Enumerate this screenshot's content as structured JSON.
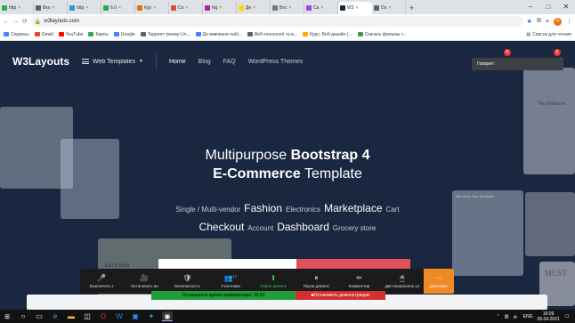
{
  "browser": {
    "tabs": [
      {
        "label": "http",
        "color": "#34a853"
      },
      {
        "label": "Вхо",
        "color": "#5f6368"
      },
      {
        "label": "http",
        "color": "#1fa2c7"
      },
      {
        "label": "6.0",
        "color": "#34a853"
      },
      {
        "label": "Кур",
        "color": "#e8710a"
      },
      {
        "label": "Co",
        "color": "#dd4b39"
      },
      {
        "label": "Ng",
        "color": "#b0249b"
      },
      {
        "label": "Де",
        "color": "#ffd500"
      },
      {
        "label": "Boc",
        "color": "#777777"
      },
      {
        "label": "Ca",
        "color": "#a142f4"
      },
      {
        "label": "W3",
        "color": "#1a2740",
        "active": true
      },
      {
        "label": "Do",
        "color": "#5f6368"
      }
    ],
    "url": "w3layouts.com",
    "profile_letter": "A",
    "bookmarks": [
      {
        "label": "Сервисы",
        "color": "#4285f4"
      },
      {
        "label": "Gmail",
        "color": "#ea4335"
      },
      {
        "label": "YouTube",
        "color": "#ff0000"
      },
      {
        "label": "Карты",
        "color": "#34a853"
      },
      {
        "label": "Google",
        "color": "#4285f4"
      },
      {
        "label": "Торрент трекер Un...",
        "color": "#5f6368"
      },
      {
        "label": "До вивчення лабі...",
        "color": "#4285f4"
      },
      {
        "label": "Веб-технології та в...",
        "color": "#5f6368"
      },
      {
        "label": "Курс: Веб-дизайн (...",
        "color": "#f9ab00"
      },
      {
        "label": "Скачать фильмы т...",
        "color": "#3c9b41"
      }
    ],
    "reading_list": "Список для чтения"
  },
  "site": {
    "logo": "W3Layouts",
    "menu_label": "Web Templates",
    "nav": [
      "Home",
      "Blog",
      "FAQ",
      "WordPress Themes"
    ],
    "badges": [
      "0",
      "0"
    ],
    "tooltip": "Говорит:"
  },
  "hero": {
    "line1_light": "Multipurpose ",
    "line1_bold": "Bootstrap 4",
    "line2_bold": "E-Commerce",
    "line2_light": " Template",
    "tags_row1": [
      {
        "text": "Single / Multi-vendor",
        "size": "sm"
      },
      {
        "text": "Fashion",
        "size": "lg"
      },
      {
        "text": "Electronics",
        "size": "sm"
      },
      {
        "text": "Marketplace",
        "size": "lg"
      },
      {
        "text": "Cart",
        "size": "sm"
      }
    ],
    "tags_row2": [
      {
        "text": "Checkout",
        "size": "lg"
      },
      {
        "text": "Account",
        "size": "sm"
      },
      {
        "text": "Dashboard",
        "size": "lg"
      },
      {
        "text": "Grocery store",
        "size": "sm"
      }
    ],
    "card_fragments": {
      "we_grow": "We Grow Your Business",
      "brilliant": "The Brilliant w",
      "must": "MUST",
      "eat_fresh": "Eat Fresh"
    }
  },
  "zoom": {
    "controls": [
      {
        "icon": "mic-icon",
        "glyph": "🎤",
        "label": "Выключить з"
      },
      {
        "icon": "camera-icon",
        "glyph": "🎥",
        "label": "Остановить ви"
      },
      {
        "icon": "shield-icon",
        "glyph": "🛡",
        "label": "Безопасность"
      },
      {
        "icon": "participants-icon",
        "glyph": "👥",
        "label": "Участники",
        "count": "17"
      },
      {
        "icon": "share-icon",
        "glyph": "⬆",
        "label": "Новая демонс",
        "green": true
      },
      {
        "icon": "pause-icon",
        "glyph": "⏸",
        "label": "Пауза демонс"
      },
      {
        "icon": "pen-icon",
        "glyph": "✏",
        "label": "Комментир"
      },
      {
        "icon": "remote-control-icon",
        "glyph": "🖱",
        "label": "Дистанционное уп"
      },
      {
        "icon": "more-icon",
        "glyph": "⋯",
        "label": "Дополнит",
        "orange": true
      }
    ],
    "timer": "Оставшееся время конференции: 02:03",
    "stop": "Остановить демонстрацию"
  },
  "taskbar": {
    "lang": "ENG",
    "time": "16:09",
    "date": "05.04.2021"
  }
}
